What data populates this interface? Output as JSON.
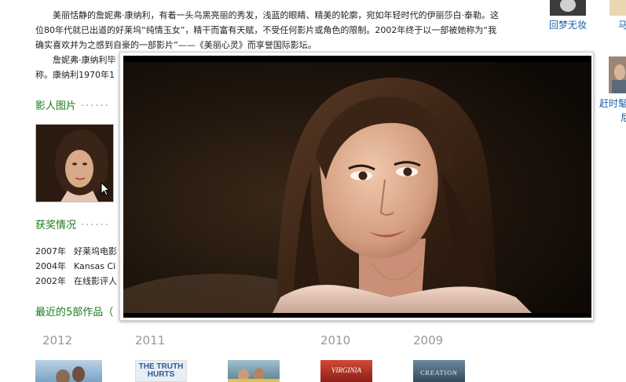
{
  "bio": {
    "para1": "美丽恬静的詹妮弗·康纳利，有着一头乌黑亮丽的秀发，浅蓝的眼睛、精美的轮廓，宛如年轻时代的伊丽莎白·泰勒。这位80年代就已出道的好莱坞“纯情玉女”，精干而富有天赋，不受任何影片或角色的限制。2002年终于以一部被她称为“我确实喜欢并为之感到自豪的一部影片”——《美丽心灵》而享誉国际影坛。",
    "para2_line1": "詹妮弗·康纳利毕",
    "para2_line2": "称。康纳利1970年1"
  },
  "sections": {
    "photos_title": "影人图片",
    "awards_title": "获奖情况",
    "works_title": "最近的5部作品（",
    "dots": "······"
  },
  "awards": [
    {
      "year": "2007年",
      "text": "好莱坞电影"
    },
    {
      "year": "2004年",
      "text": "Kansas Ci"
    },
    {
      "year": "2002年",
      "text": "在线影评人"
    }
  ],
  "works_years": [
    "2012",
    "2011",
    "2010",
    "2009"
  ],
  "posters": [
    {
      "title": "",
      "color": "#7aa3c4"
    },
    {
      "title": "THE TRUTH HURTS",
      "color": "#e9eef3"
    },
    {
      "title": "",
      "color": "#7aa0b0"
    },
    {
      "title": "VIRGINIA",
      "color": "#c23a2a"
    },
    {
      "title": "CREATION",
      "color": "#4a6a80"
    }
  ],
  "right": {
    "link1": "回梦无妆",
    "link2": "马",
    "link3": "赶时髦",
    "link4": "尼"
  },
  "popup": {
    "image_subject": "portrait-photo"
  },
  "colors": {
    "link": "#1a5fa8",
    "section": "#1a7a1a",
    "year": "#999999"
  }
}
